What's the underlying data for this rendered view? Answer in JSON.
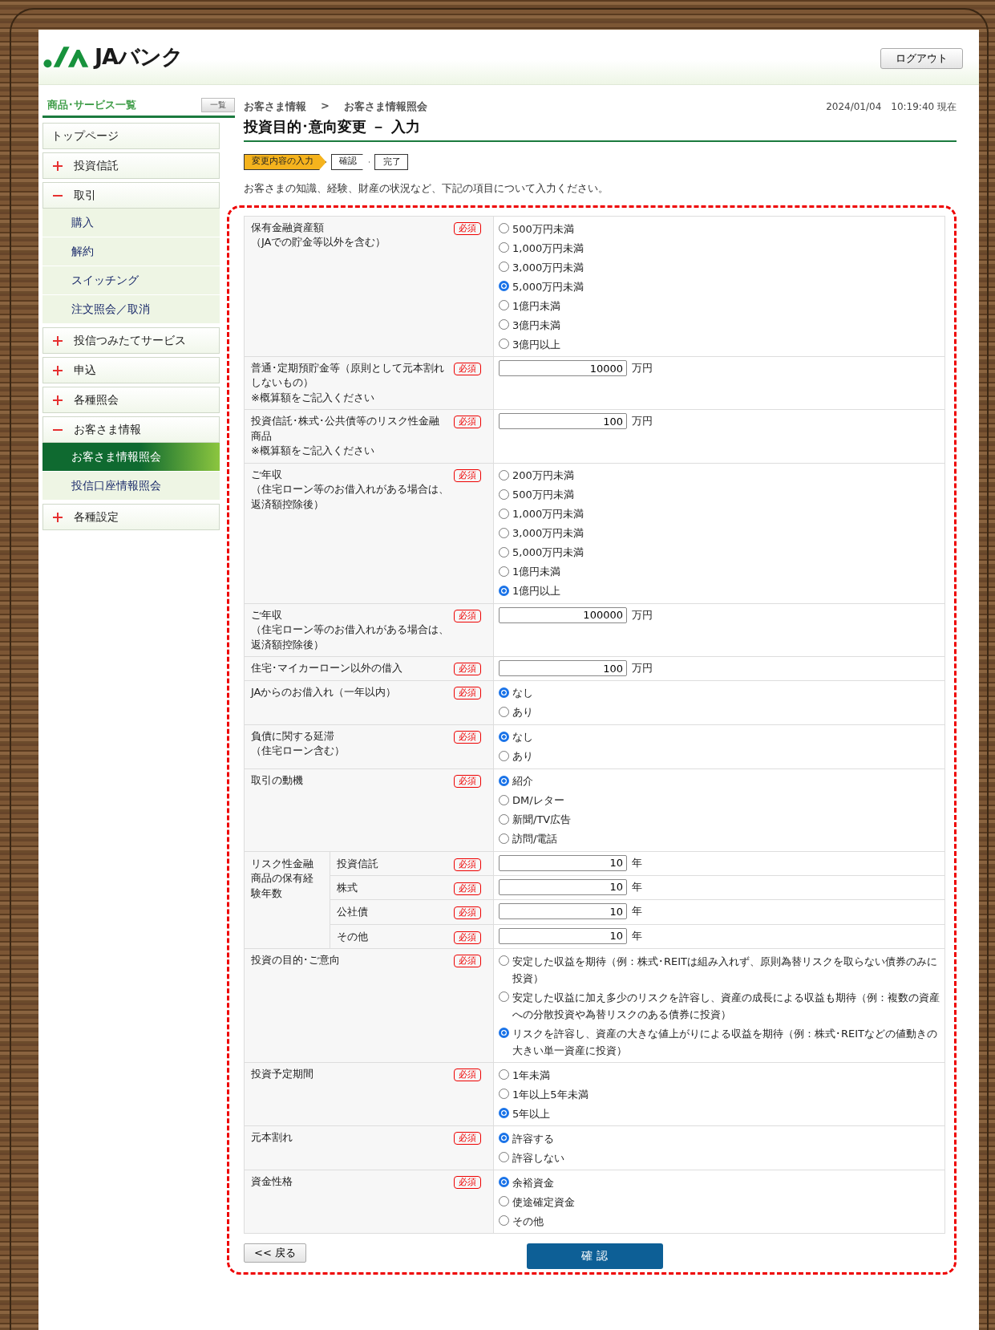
{
  "header": {
    "logo_text": "JAバンク",
    "logout_button": "ログアウト"
  },
  "sidebar": {
    "title": "商品･サービス一覧",
    "list_button": "一覧",
    "items": [
      {
        "label": "トップページ",
        "kind": "link"
      },
      {
        "label": "投資信託",
        "kind": "group",
        "expanded": false
      },
      {
        "label": "取引",
        "kind": "group",
        "expanded": true,
        "children": [
          {
            "label": "購入",
            "selected": false
          },
          {
            "label": "解約",
            "selected": false
          },
          {
            "label": "スイッチング",
            "selected": false
          },
          {
            "label": "注文照会／取消",
            "selected": false
          }
        ]
      },
      {
        "label": "投信つみたてサービス",
        "kind": "group",
        "expanded": false
      },
      {
        "label": "申込",
        "kind": "group",
        "expanded": false
      },
      {
        "label": "各種照会",
        "kind": "group",
        "expanded": false
      },
      {
        "label": "お客さま情報",
        "kind": "group",
        "expanded": true,
        "children": [
          {
            "label": "お客さま情報照会",
            "selected": true
          },
          {
            "label": "投信口座情報照会",
            "selected": false
          }
        ]
      },
      {
        "label": "各種設定",
        "kind": "group",
        "expanded": false
      }
    ]
  },
  "breadcrumb": {
    "items": [
      "お客さま情報",
      "お客さま情報照会"
    ],
    "separator": ">"
  },
  "timestamp": "2024/01/04　10:19:40 現在",
  "page_title": "投資目的･意向変更 － 入力",
  "steps": [
    {
      "label": "変更内容の入力",
      "selected": true
    },
    {
      "label": "確認",
      "selected": false
    },
    {
      "label": "完了",
      "selected": false
    }
  ],
  "intro": "お客さまの知識、経験、財産の状況など、下記の項目について入力ください。",
  "form": {
    "rows": [
      {
        "kind": "radio",
        "label": "保有金融資産額",
        "note": "（JAでの貯金等以外を含む）",
        "badge": "必須",
        "options": [
          {
            "label": "500万円未満",
            "selected": false
          },
          {
            "label": "1,000万円未満",
            "selected": false
          },
          {
            "label": "3,000万円未満",
            "selected": false
          },
          {
            "label": "5,000万円未満",
            "selected": true
          },
          {
            "label": "1億円未満",
            "selected": false
          },
          {
            "label": "3億円未満",
            "selected": false
          },
          {
            "label": "3億円以上",
            "selected": false
          }
        ]
      },
      {
        "kind": "number",
        "label": "普通･定期預貯金等（原則として元本割れしないもの）",
        "note": "※概算額をご記入ください",
        "badge": "必須",
        "value": "10000",
        "unit": "万円"
      },
      {
        "kind": "number",
        "label": "投資信託･株式･公共債等のリスク性金融商品",
        "note": "※概算額をご記入ください",
        "badge": "必須",
        "value": "100",
        "unit": "万円"
      },
      {
        "kind": "radio",
        "label": "ご年収",
        "note": "（住宅ローン等のお借入れがある場合は、返済額控除後）",
        "badge": "必須",
        "options": [
          {
            "label": "200万円未満",
            "selected": false
          },
          {
            "label": "500万円未満",
            "selected": false
          },
          {
            "label": "1,000万円未満",
            "selected": false
          },
          {
            "label": "3,000万円未満",
            "selected": false
          },
          {
            "label": "5,000万円未満",
            "selected": false
          },
          {
            "label": "1億円未満",
            "selected": false
          },
          {
            "label": "1億円以上",
            "selected": true
          }
        ]
      },
      {
        "kind": "number",
        "label": "ご年収",
        "note": "（住宅ローン等のお借入れがある場合は、返済額控除後）",
        "badge": "必須",
        "value": "100000",
        "unit": "万円"
      },
      {
        "kind": "number",
        "label": "住宅･マイカーローン以外の借入",
        "badge": "必須",
        "value": "100",
        "unit": "万円"
      },
      {
        "kind": "radio",
        "label": "JAからのお借入れ（一年以内）",
        "badge": "必須",
        "options": [
          {
            "label": "なし",
            "selected": true
          },
          {
            "label": "あり",
            "selected": false
          }
        ]
      },
      {
        "kind": "radio",
        "label": "負債に関する延滞",
        "note": "（住宅ローン含む）",
        "badge": "必須",
        "options": [
          {
            "label": "なし",
            "selected": true
          },
          {
            "label": "あり",
            "selected": false
          }
        ]
      },
      {
        "kind": "radio",
        "label": "取引の動機",
        "badge": "必須",
        "options": [
          {
            "label": "紹介",
            "selected": true
          },
          {
            "label": "DM/レター",
            "selected": false
          },
          {
            "label": "新聞/TV広告",
            "selected": false
          },
          {
            "label": "訪問/電話",
            "selected": false
          }
        ]
      },
      {
        "kind": "group",
        "label": "リスク性金融商品の保有経験年数",
        "children": [
          {
            "kind": "number",
            "label": "投資信託",
            "badge": "必須",
            "value": "10",
            "unit": "年"
          },
          {
            "kind": "number",
            "label": "株式",
            "badge": "必須",
            "value": "10",
            "unit": "年"
          },
          {
            "kind": "number",
            "label": "公社債",
            "badge": "必須",
            "value": "10",
            "unit": "年"
          },
          {
            "kind": "number",
            "label": "その他",
            "badge": "必須",
            "value": "10",
            "unit": "年"
          }
        ]
      },
      {
        "kind": "radio",
        "label": "投資の目的･ご意向",
        "badge": "必須",
        "options": [
          {
            "label": "安定した収益を期待（例：株式･REITは組み入れず、原則為替リスクを取らない債券のみに投資）",
            "selected": false
          },
          {
            "label": "安定した収益に加え多少のリスクを許容し、資産の成長による収益も期待（例：複数の資産への分散投資や為替リスクのある債券に投資）",
            "selected": false
          },
          {
            "label": "リスクを許容し、資産の大きな値上がりによる収益を期待（例：株式･REITなどの値動きの大きい単一資産に投資）",
            "selected": true
          }
        ]
      },
      {
        "kind": "radio",
        "label": "投資予定期間",
        "badge": "必須",
        "options": [
          {
            "label": "1年未満",
            "selected": false
          },
          {
            "label": "1年以上5年未満",
            "selected": false
          },
          {
            "label": "5年以上",
            "selected": true
          }
        ]
      },
      {
        "kind": "radio",
        "label": "元本割れ",
        "badge": "必須",
        "options": [
          {
            "label": "許容する",
            "selected": true
          },
          {
            "label": "許容しない",
            "selected": false
          }
        ]
      },
      {
        "kind": "radio",
        "label": "資金性格",
        "badge": "必須",
        "options": [
          {
            "label": "余裕資金",
            "selected": true
          },
          {
            "label": "使途確定資金",
            "selected": false
          },
          {
            "label": "その他",
            "selected": false
          }
        ]
      }
    ]
  },
  "buttons": {
    "back": "<< 戻る",
    "confirm": "確 認"
  }
}
